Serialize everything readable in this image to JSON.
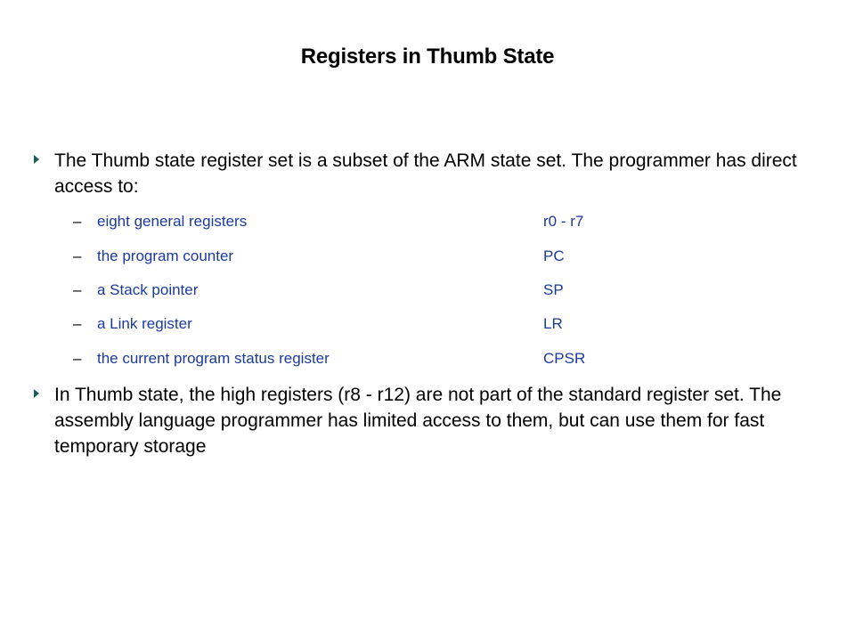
{
  "slide": {
    "title": "Registers in Thumb State",
    "bullets": [
      {
        "icon": "triangle-bullet-icon",
        "text": "The Thumb state register set is a subset of the ARM state set. The programmer has direct access to:"
      },
      {
        "icon": "triangle-bullet-icon",
        "text": "In Thumb state, the high registers (r8 - r12) are not part of the standard register set. The assembly language programmer has limited access to them, but can use them for fast temporary storage"
      }
    ],
    "sub_items": [
      {
        "dash": "–",
        "description": "eight general registers",
        "register": "r0 - r7"
      },
      {
        "dash": "–",
        "description": "the program counter",
        "register": "PC"
      },
      {
        "dash": "–",
        "description": "a Stack pointer",
        "register": "SP"
      },
      {
        "dash": "–",
        "description": "a Link register",
        "register": "LR"
      },
      {
        "dash": "–",
        "description": "the current program status register",
        "register": "CPSR"
      }
    ]
  },
  "colors": {
    "bullet_marker": "#1b5c5c",
    "sub_item_text": "#1b3a9c",
    "body_text": "#000000",
    "background": "#ffffff"
  }
}
